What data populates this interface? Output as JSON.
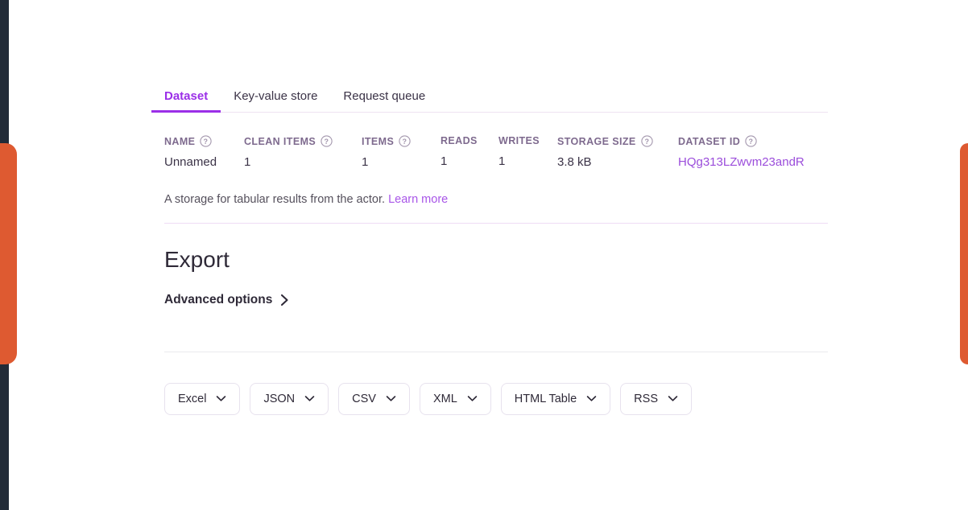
{
  "theme": {
    "accent_purple": "#9b2fe8",
    "link_purple": "#a855e8",
    "nav_rail": "#222b38",
    "drawer_orange": "#de5a31",
    "header_mauve": "#7e6a8e",
    "text_dark": "#2f2a38"
  },
  "tabs": [
    {
      "label": "Dataset",
      "active": true
    },
    {
      "label": "Key-value store",
      "active": false
    },
    {
      "label": "Request queue",
      "active": false
    }
  ],
  "stats": {
    "columns": [
      {
        "header": "NAME",
        "value": "Unnamed",
        "help": true,
        "link": false,
        "icon": "help-circle-icon"
      },
      {
        "header": "CLEAN ITEMS",
        "value": "1",
        "help": true,
        "link": false,
        "icon": "help-circle-icon"
      },
      {
        "header": "ITEMS",
        "value": "1",
        "help": true,
        "link": false,
        "icon": "help-circle-icon"
      },
      {
        "header": "READS",
        "value": "1",
        "help": false,
        "link": false,
        "icon": ""
      },
      {
        "header": "WRITES",
        "value": "1",
        "help": false,
        "link": false,
        "icon": ""
      },
      {
        "header": "STORAGE SIZE",
        "value": "3.8 kB",
        "help": true,
        "link": false,
        "icon": "help-circle-icon"
      },
      {
        "header": "DATASET ID",
        "value": "HQg313LZwvm23andR",
        "help": true,
        "link": true,
        "icon": "help-circle-icon"
      }
    ]
  },
  "description": {
    "text": "A storage for tabular results from the actor.",
    "link_label": "Learn more"
  },
  "export": {
    "title": "Export",
    "advanced_options_label": "Advanced options",
    "advanced_options_icon": "chevron-right-icon",
    "buttons": [
      {
        "label": "Excel",
        "icon": "chevron-down-icon"
      },
      {
        "label": "JSON",
        "icon": "chevron-down-icon"
      },
      {
        "label": "CSV",
        "icon": "chevron-down-icon"
      },
      {
        "label": "XML",
        "icon": "chevron-down-icon"
      },
      {
        "label": "HTML Table",
        "icon": "chevron-down-icon"
      },
      {
        "label": "RSS",
        "icon": "chevron-down-icon"
      }
    ]
  }
}
